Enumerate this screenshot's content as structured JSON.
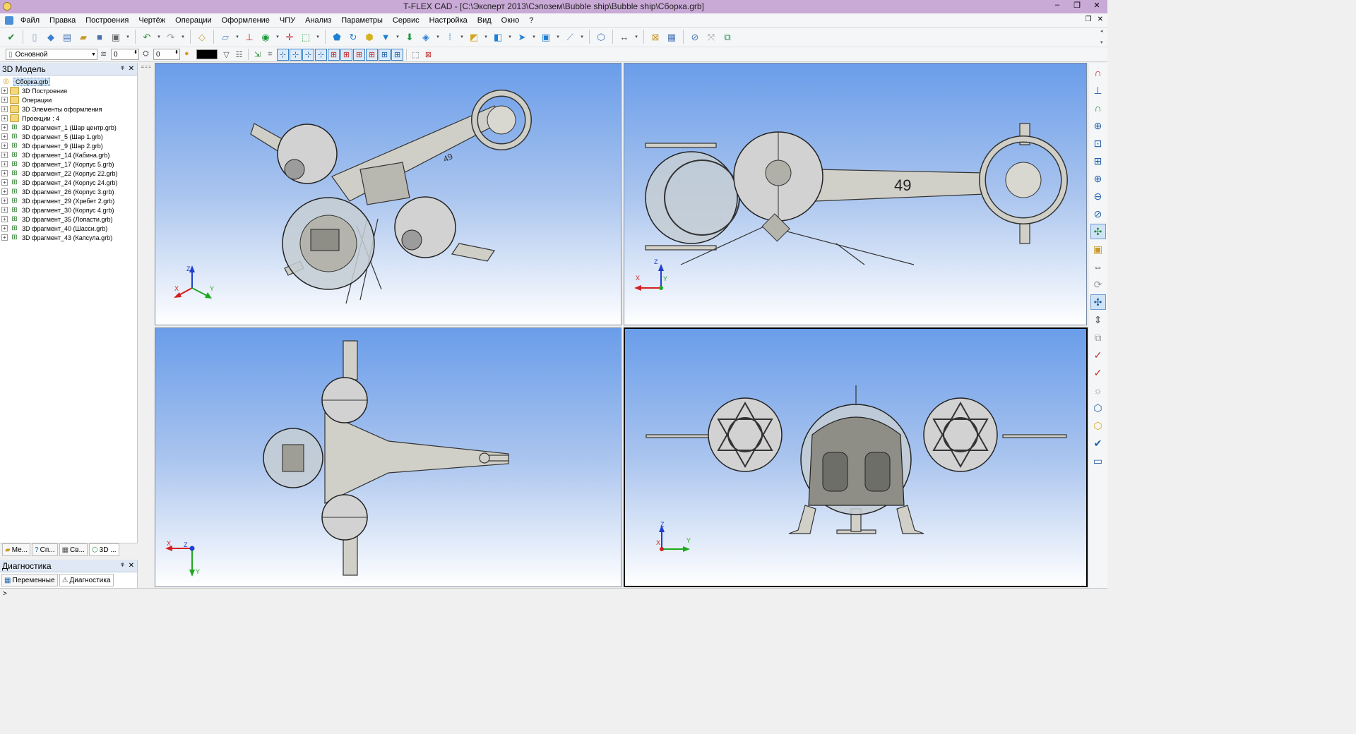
{
  "titlebar": {
    "title": "T-FLEX CAD - [C:\\Эксперт 2013\\Сэпозем\\Bubble ship\\Bubble ship\\Сборка.grb]",
    "minimize": "–",
    "restore": "❐",
    "close": "✕"
  },
  "menubar": {
    "items": [
      "Файл",
      "Правка",
      "Построения",
      "Чертёж",
      "Операции",
      "Оформление",
      "ЧПУ",
      "Анализ",
      "Параметры",
      "Сервис",
      "Настройка",
      "Вид",
      "Окно",
      "?"
    ],
    "mdi": {
      "restore": "❐",
      "close": "✕"
    }
  },
  "toolbar2": {
    "layer": "Основной",
    "spin1": "0",
    "spin2": "0"
  },
  "model_panel": {
    "title": "3D Модель",
    "pin": "ᵠ",
    "close": "✕",
    "root": "Сборка.grb",
    "items": [
      {
        "label": "3D Построения",
        "type": "folder"
      },
      {
        "label": "Операции",
        "type": "folder"
      },
      {
        "label": "3D Элементы оформления",
        "type": "folder"
      },
      {
        "label": "Проекции : 4",
        "type": "folder"
      },
      {
        "label": "3D фрагмент_1 (Шар центр.grb)",
        "type": "frag"
      },
      {
        "label": "3D фрагмент_5 (Шар 1.grb)",
        "type": "frag"
      },
      {
        "label": "3D фрагмент_9 (Шар 2.grb)",
        "type": "frag"
      },
      {
        "label": "3D фрагмент_14 (Кабина.grb)",
        "type": "frag"
      },
      {
        "label": "3D фрагмент_17 (Корпус 5.grb)",
        "type": "frag"
      },
      {
        "label": "3D фрагмент_22 (Корпус 22.grb)",
        "type": "frag"
      },
      {
        "label": "3D фрагмент_24 (Корпус 24.grb)",
        "type": "frag"
      },
      {
        "label": "3D фрагмент_26 (Корпус 3.grb)",
        "type": "frag"
      },
      {
        "label": "3D фрагмент_29 (Хребет 2.grb)",
        "type": "frag"
      },
      {
        "label": "3D фрагмент_30 (Корпус 4.grb)",
        "type": "frag"
      },
      {
        "label": "3D фрагмент_35 (Лопасти.grb)",
        "type": "frag"
      },
      {
        "label": "3D фрагмент_40 (Шасси.grb)",
        "type": "frag"
      },
      {
        "label": "3D фрагмент_43 (Капсула.grb)",
        "type": "frag"
      }
    ],
    "tabs": [
      "Ме...",
      "Сп...",
      "Св...",
      "3D ..."
    ]
  },
  "diag_panel": {
    "title": "Диагностика",
    "tabs": [
      "Переменные",
      "Диагностика"
    ]
  },
  "statusbar": {
    "text": ">"
  },
  "axes": {
    "x": "X",
    "y": "Y",
    "z": "Z"
  },
  "viewports": {
    "iso": {
      "number_label": "49"
    },
    "front": {
      "number_label": "49"
    }
  },
  "colors": {
    "viewport_top": "#6a9dea",
    "viewport_bottom": "#ffffff",
    "axis_x": "#d42020",
    "axis_y": "#1fa81f",
    "axis_z": "#1f3fd0"
  }
}
